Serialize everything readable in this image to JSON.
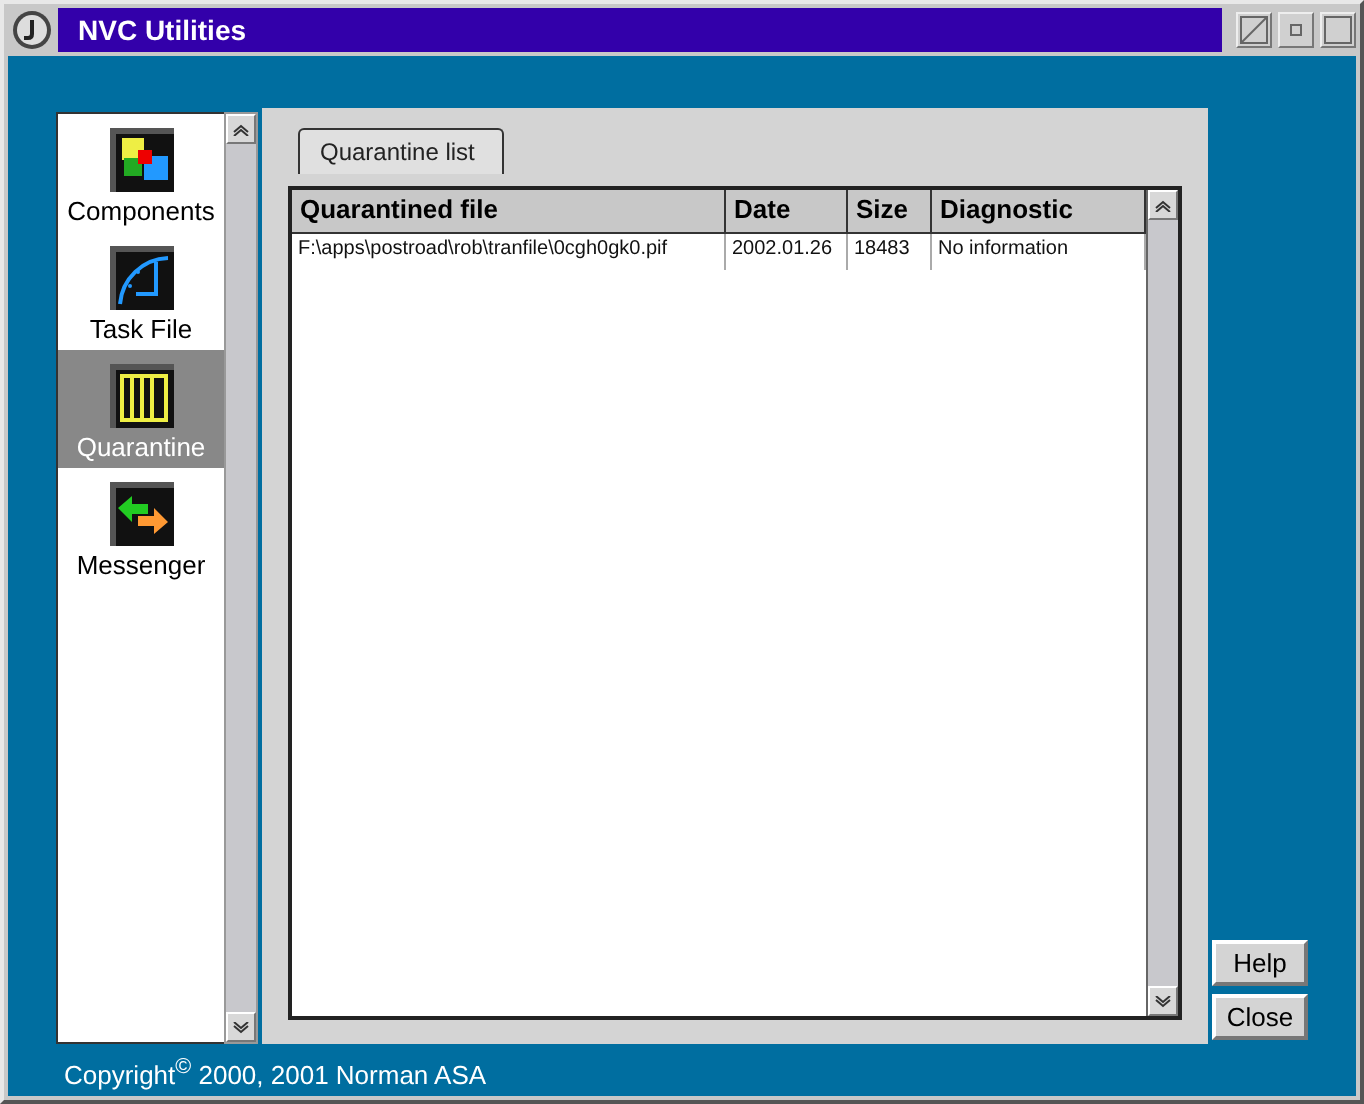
{
  "window": {
    "title": "NVC Utilities"
  },
  "sidebar": {
    "items": [
      {
        "label": "Components",
        "kind": "components",
        "selected": false
      },
      {
        "label": "Task File",
        "kind": "taskfile",
        "selected": false
      },
      {
        "label": "Quarantine",
        "kind": "quarantine",
        "selected": true
      },
      {
        "label": "Messenger",
        "kind": "messenger",
        "selected": false
      }
    ]
  },
  "tabs": [
    {
      "label": "Quarantine list",
      "selected": true
    }
  ],
  "table": {
    "columns": [
      "Quarantined file",
      "Date",
      "Size",
      "Diagnostic"
    ],
    "rows": [
      [
        "F:\\apps\\postroad\\rob\\tranfile\\0cgh0gk0.pif",
        "2002.01.26",
        "18483",
        "No information"
      ]
    ]
  },
  "buttons": [
    "Help",
    "Close"
  ],
  "footer": "Copyright$^{©}$ 2000, 2001 Norman ASA"
}
